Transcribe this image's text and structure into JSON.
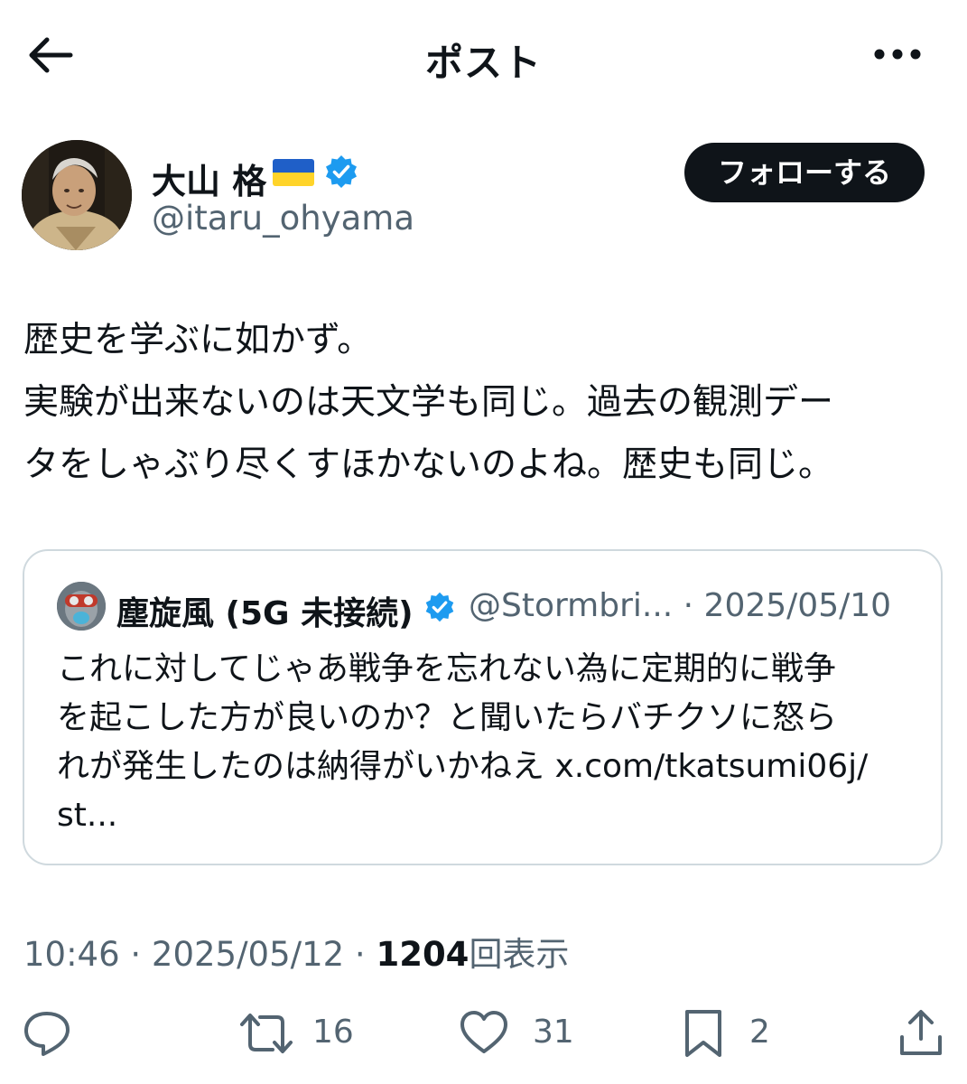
{
  "header": {
    "title": "ポスト",
    "back_icon": "arrow-left-icon",
    "more_icon": "more-icon"
  },
  "author": {
    "display_name": "大山 格",
    "flag": "ukraine-flag-icon",
    "verified_icon": "verified-badge-icon",
    "handle": "@itaru_ohyama",
    "follow_label": "フォローする"
  },
  "post": {
    "lines": [
      "歴史を学ぶに如かず。",
      "実験が出来ないのは天文学も同じ。過去の観測デー",
      "タをしゃぶり尽くすほかないのよね。歴史も同じ。"
    ]
  },
  "quote": {
    "display_name": "塵旋風 (5G 未接続)",
    "handle_and_date": "@Stormbri... · 2025/05/10",
    "lines": [
      "これに対してじゃあ戦争を忘れない為に定期的に戦争",
      "を起こした方が良いのか？と聞いたらバチクソに怒ら",
      "れが発生したのは納得がいかねえ x.com/tkatsumi06j/",
      "st..."
    ]
  },
  "meta": {
    "time_date": "10:46 · 2025/05/12 · ",
    "views_count": "1204",
    "views_label": "回表示"
  },
  "actions": {
    "reply": {
      "icon": "reply-icon",
      "count": ""
    },
    "repost": {
      "icon": "repost-icon",
      "count": "16"
    },
    "like": {
      "icon": "heart-icon",
      "count": "31"
    },
    "bookmark": {
      "icon": "bookmark-icon",
      "count": "2"
    },
    "share": {
      "icon": "share-icon",
      "count": ""
    }
  },
  "colors": {
    "text": "#0f1419",
    "secondary": "#536471",
    "verified": "#1d9bf0",
    "border": "#cfd9de"
  }
}
